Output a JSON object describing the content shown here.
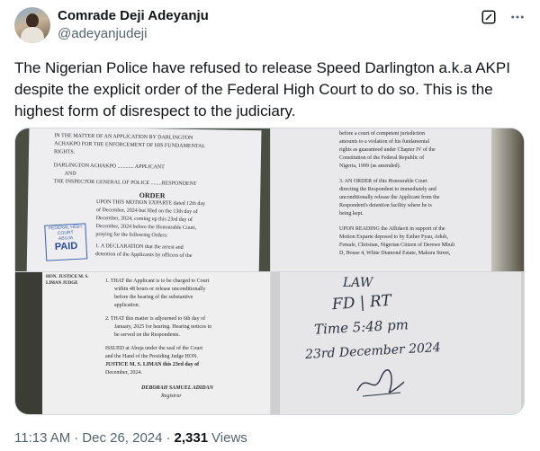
{
  "author": {
    "display_name": "Comrade Deji Adeyanju",
    "handle": "@adeyanjudeji"
  },
  "tweet_text": "The Nigerian Police have refused to release Speed Darlington a.k.a AKPI despite the explicit order of the Federal High Court to do so. This is the highest form of disrespect to the judiciary.",
  "icons": {
    "grok": "grok-icon",
    "more": "more-icon"
  },
  "photos": [
    {
      "lines": [
        "IN THE MATTER OF AN APPLICATION BY DARLINGTON",
        "ACHAKPO FOR THE ENFORCEMENT OF HIS FUNDAMENTAL",
        "RIGHTS.",
        "DARLINGTON ACHAKPO ............ APPLICANT",
        "AND",
        "THE INSPECTOR GENERAL OF POLICE ........RESPONDENT",
        "ORDER",
        "UPON THIS MOTION EXPARTE dated 12th day",
        "of December, 2024 but filed on the 13th day of",
        "December, 2024, coming up this 23rd day of",
        "December, 2024 before the Honourable Court,",
        "praying for the following Orders:",
        "1. A DECLARATION that the arrest and",
        "detention of the Applicants by officers of the"
      ],
      "stamp": [
        "FEDERAL HIGH COURT",
        "ABUJA",
        "PAID"
      ]
    },
    {
      "lines": [
        "before a court of competent jurisdiction",
        "amounts to a violation of his fundamental",
        "rights as guaranteed under Chapter IV of the",
        "Constitution of the Federal Republic of",
        "Nigeria, 1999 (as amended).",
        "3. AN ORDER of this Honourable Court",
        "directing the Respondent to immediately and",
        "unconditionally release the Applicant from the",
        "Respondent's detention facility where he is",
        "being kept.",
        "UPON READING the Affidavit in support of the",
        "Motion Exparte deposed to by Esther Fyau, Adult,",
        "Female, Christian, Nigerian Citizen of Derewe Mbuli",
        "D, House 4, White Diamond Estate, Makura Street,"
      ]
    },
    {
      "side_label": "HON. JUSTICE M. S. LIMAN JUDGE",
      "lines": [
        "1. THAT the Applicant is to be charged to Court",
        "within 48 hours or release unconditionally",
        "before the hearing of the substantive",
        "application.",
        "2. THAT this matter is adjourned to 6th day of",
        "January, 2025 for hearing. Hearing notices to",
        "be served on the Respondents.",
        "ISSUED at Abuja under the seal of the Court",
        "and the Hand of the Presiding Judge HON.",
        "JUSTICE M. S. LIMAN this 23rd day of",
        "December, 2024.",
        "DEBORAH SAMUEL ADIDAN",
        "Registrar"
      ]
    },
    {
      "handwriting": [
        "LAW",
        "FD | RT",
        "Time 5:48 pm",
        "23rd December 2024"
      ]
    }
  ],
  "meta": {
    "time": "11:13 AM",
    "separator": "·",
    "date": "Dec 26, 2024",
    "views_count": "2,331",
    "views_label": "Views"
  }
}
